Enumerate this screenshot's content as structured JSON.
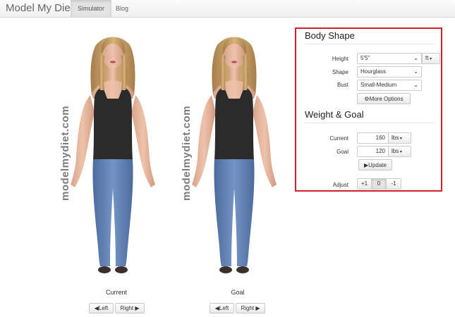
{
  "navbar": {
    "brand": "Model My Diet",
    "tabs": [
      {
        "label": "Simulator",
        "active": true
      },
      {
        "label": "Blog",
        "active": false
      }
    ]
  },
  "watermark": "modelmydiet.com",
  "models": [
    {
      "caption": "Current",
      "left_label": "◀Left",
      "right_label": "Right ▶"
    },
    {
      "caption": "Goal",
      "left_label": "◀Left",
      "right_label": "Right ▶"
    }
  ],
  "body_shape": {
    "title": "Body Shape",
    "height_label": "Height",
    "height_value": "5'5\"",
    "height_unit": "ft",
    "shape_label": "Shape",
    "shape_value": "Hourglass",
    "bust_label": "Bust",
    "bust_value": "Small-Medium",
    "more_options": "More Options"
  },
  "weight_goal": {
    "title": "Weight & Goal",
    "current_label": "Current",
    "current_value": "160",
    "current_unit": "lbs",
    "goal_label": "Goal",
    "goal_value": "120",
    "goal_unit": "lbs",
    "update_label": "▶Update",
    "adjust_label": "Adjust",
    "adjust_options": [
      "+1",
      "0",
      "-1"
    ],
    "adjust_selected": "0"
  },
  "colors": {
    "panel_border": "#d0202a",
    "jeans": "#5e7fb2",
    "tank_top": "#2b2b2b"
  }
}
